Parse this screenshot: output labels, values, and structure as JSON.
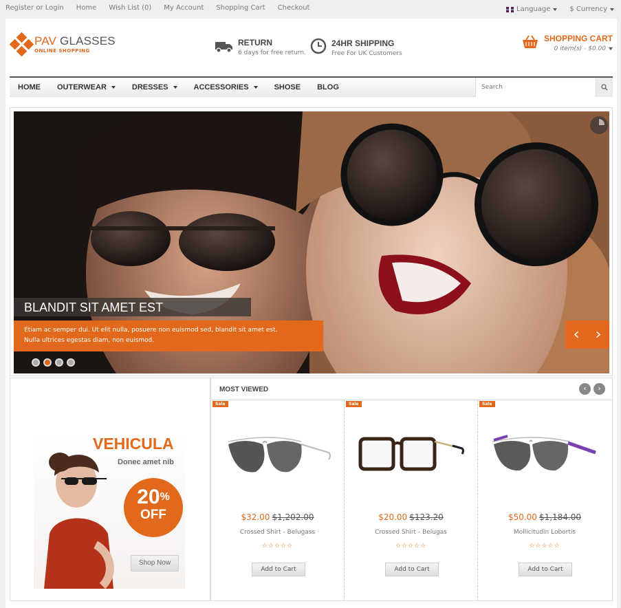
{
  "topbar": {
    "links": [
      "Register or Login",
      "Home",
      "Wish List (0)",
      "My Account",
      "Shopping Cart",
      "Checkout"
    ],
    "language_label": "Language",
    "currency_label": "$ Currency"
  },
  "header": {
    "logo_name_1": "PAV",
    "logo_name_2": "GLASSES",
    "logo_tagline": "ONLINE SHOPPING",
    "features": [
      {
        "icon": "truck-icon",
        "title": "RETURN",
        "subtitle": "6 days for free return."
      },
      {
        "icon": "clock-icon",
        "title": "24HR SHIPPING",
        "subtitle": "Free For UK Customers"
      }
    ],
    "cart": {
      "title": "SHOPPING CART",
      "summary": "0 item(s) - $0.00",
      "icon": "basket-icon"
    }
  },
  "nav": {
    "items": [
      {
        "label": "HOME",
        "dropdown": false
      },
      {
        "label": "OUTERWEAR",
        "dropdown": true
      },
      {
        "label": "DRESSES",
        "dropdown": true
      },
      {
        "label": "ACCESSORIES",
        "dropdown": true
      },
      {
        "label": "SHOSE",
        "dropdown": false
      },
      {
        "label": "BLOG",
        "dropdown": false
      }
    ],
    "search_placeholder": "Search"
  },
  "slider": {
    "title": "BLANDIT SIT AMET EST",
    "description_1": "Etiam ac semper dui. Ut elit nulla, posuere non euismod sed, blandit sit amet est.",
    "description_2": "Nulla ultrices egestas diam, non euismod.",
    "bullets": 4,
    "active_bullet": 2,
    "prev_glyph": "‹",
    "next_glyph": "›"
  },
  "promo": {
    "headline": "VEHICULA",
    "subline": "Donec amet nib",
    "percent": "20",
    "percent_sign": "%",
    "off": "OFF",
    "button": "Shop Now"
  },
  "most_viewed": {
    "title": "MOST VIEWED",
    "products": [
      {
        "badge": "Sale",
        "price": "$32.00",
        "old_price": "$1,202.00",
        "name": "Crossed Shirt - Belugass",
        "stars": "☆☆☆☆☆",
        "button": "Add to Cart"
      },
      {
        "badge": "Sale",
        "price": "$20.00",
        "old_price": "$123.20",
        "name": "Crossed Shirt - Belugas",
        "stars": "☆☆☆☆☆",
        "button": "Add to Cart"
      },
      {
        "badge": "Sale",
        "price": "$50.00",
        "old_price": "$1,184.00",
        "name": "Mollicitudin Lobortis",
        "stars": "☆☆☆☆☆",
        "button": "Add to Cart"
      }
    ]
  },
  "colors": {
    "accent": "#e2681b",
    "nav_border": "#555555",
    "background": "#efefef"
  }
}
